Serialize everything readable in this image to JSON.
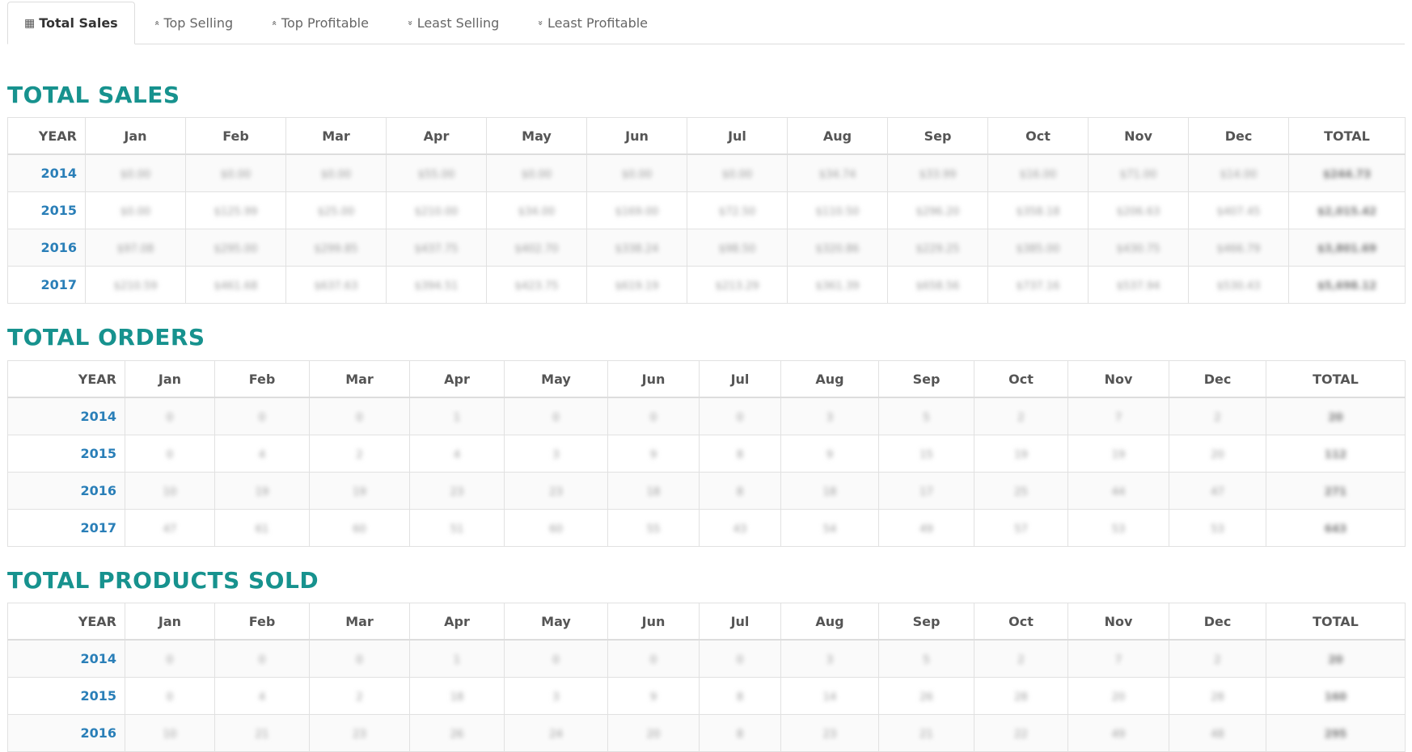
{
  "tabs": [
    {
      "label": "Total Sales",
      "icon": "table-icon",
      "glyph": "▦",
      "active": true
    },
    {
      "label": "Top Selling",
      "icon": "double-chevron-up-icon",
      "glyph": "«",
      "active": false
    },
    {
      "label": "Top Profitable",
      "icon": "double-chevron-up-icon",
      "glyph": "«",
      "active": false
    },
    {
      "label": "Least Selling",
      "icon": "double-chevron-down-icon",
      "glyph": "»",
      "active": false
    },
    {
      "label": "Least Profitable",
      "icon": "double-chevron-down-icon",
      "glyph": "»",
      "active": false
    }
  ],
  "headers": [
    "YEAR",
    "Jan",
    "Feb",
    "Mar",
    "Apr",
    "May",
    "Jun",
    "Jul",
    "Aug",
    "Sep",
    "Oct",
    "Nov",
    "Dec",
    "TOTAL"
  ],
  "sections": {
    "sales": {
      "title": "TOTAL SALES",
      "rows": [
        {
          "year": "2014",
          "cells": [
            "$0.00",
            "$0.00",
            "$0.00",
            "$55.00",
            "$0.00",
            "$0.00",
            "$0.00",
            "$34.74",
            "$33.99",
            "$16.00",
            "$71.00",
            "$14.00"
          ],
          "total": "$244.73"
        },
        {
          "year": "2015",
          "cells": [
            "$0.00",
            "$125.99",
            "$25.00",
            "$210.00",
            "$34.00",
            "$169.00",
            "$72.50",
            "$110.50",
            "$296.20",
            "$358.18",
            "$206.63",
            "$407.45"
          ],
          "total": "$2,015.42"
        },
        {
          "year": "2016",
          "cells": [
            "$97.08",
            "$295.00",
            "$299.85",
            "$437.75",
            "$402.70",
            "$338.24",
            "$98.50",
            "$320.86",
            "$229.25",
            "$385.00",
            "$430.75",
            "$466.79"
          ],
          "total": "$3,801.69"
        },
        {
          "year": "2017",
          "cells": [
            "$210.59",
            "$461.68",
            "$637.63",
            "$394.51",
            "$423.75",
            "$619.19",
            "$213.29",
            "$361.39",
            "$658.56",
            "$737.16",
            "$537.94",
            "$530.43"
          ],
          "total": "$5,698.12"
        }
      ]
    },
    "orders": {
      "title": "TOTAL ORDERS",
      "rows": [
        {
          "year": "2014",
          "cells": [
            "0",
            "0",
            "0",
            "1",
            "0",
            "0",
            "0",
            "3",
            "5",
            "2",
            "7",
            "2"
          ],
          "total": "20"
        },
        {
          "year": "2015",
          "cells": [
            "0",
            "4",
            "2",
            "4",
            "3",
            "9",
            "8",
            "9",
            "15",
            "19",
            "19",
            "20"
          ],
          "total": "112"
        },
        {
          "year": "2016",
          "cells": [
            "10",
            "19",
            "19",
            "23",
            "23",
            "18",
            "8",
            "18",
            "17",
            "25",
            "44",
            "47"
          ],
          "total": "271"
        },
        {
          "year": "2017",
          "cells": [
            "47",
            "61",
            "60",
            "51",
            "60",
            "55",
            "43",
            "54",
            "49",
            "57",
            "53",
            "53"
          ],
          "total": "643"
        }
      ]
    },
    "products": {
      "title": "TOTAL PRODUCTS SOLD",
      "rows": [
        {
          "year": "2014",
          "cells": [
            "0",
            "0",
            "0",
            "1",
            "0",
            "0",
            "0",
            "3",
            "5",
            "2",
            "7",
            "2"
          ],
          "total": "20"
        },
        {
          "year": "2015",
          "cells": [
            "0",
            "4",
            "2",
            "18",
            "3",
            "9",
            "8",
            "14",
            "26",
            "28",
            "20",
            "28"
          ],
          "total": "160"
        },
        {
          "year": "2016",
          "cells": [
            "10",
            "21",
            "23",
            "26",
            "24",
            "20",
            "8",
            "23",
            "21",
            "22",
            "49",
            "48"
          ],
          "total": "295"
        }
      ]
    }
  },
  "colors": {
    "accent": "#17928e",
    "year_link": "#2a7fb8",
    "border": "#e1e1e1"
  }
}
